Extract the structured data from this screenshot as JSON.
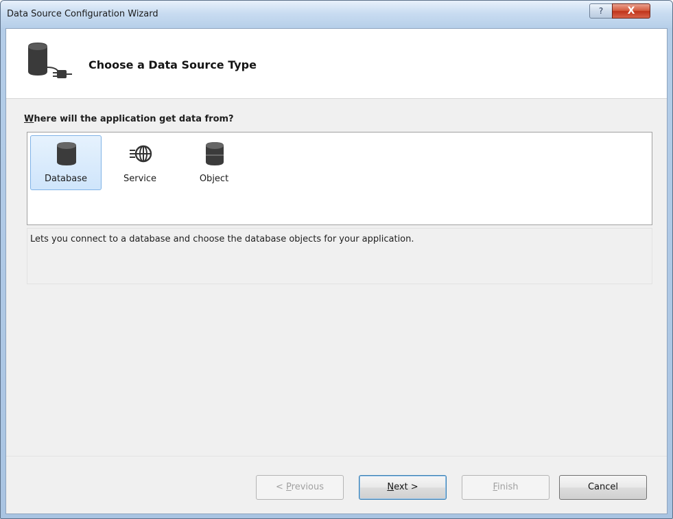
{
  "window": {
    "title": "Data Source Configuration Wizard",
    "help_label": "?",
    "close_label": "X"
  },
  "header": {
    "title": "Choose a Data Source Type"
  },
  "question": {
    "mnemonic": "W",
    "rest": "here will the application get data from?"
  },
  "choices": [
    {
      "label": "Database",
      "icon": "database-icon",
      "selected": true
    },
    {
      "label": "Service",
      "icon": "service-globe-icon",
      "selected": false
    },
    {
      "label": "Object",
      "icon": "object-icon",
      "selected": false
    }
  ],
  "description": "Lets you connect to a database and choose the database objects for your application.",
  "buttons": {
    "previous": {
      "prefix": "< ",
      "mnemonic": "P",
      "rest": "revious",
      "enabled": false
    },
    "next": {
      "mnemonic": "N",
      "rest": "ext >",
      "enabled": true
    },
    "finish": {
      "mnemonic": "F",
      "rest": "inish",
      "enabled": false
    },
    "cancel": {
      "label": "Cancel",
      "enabled": true
    }
  },
  "colors": {
    "selection_fill": "#cfe5fb",
    "selection_border": "#7fb2e6",
    "close_red": "#c0341a"
  }
}
